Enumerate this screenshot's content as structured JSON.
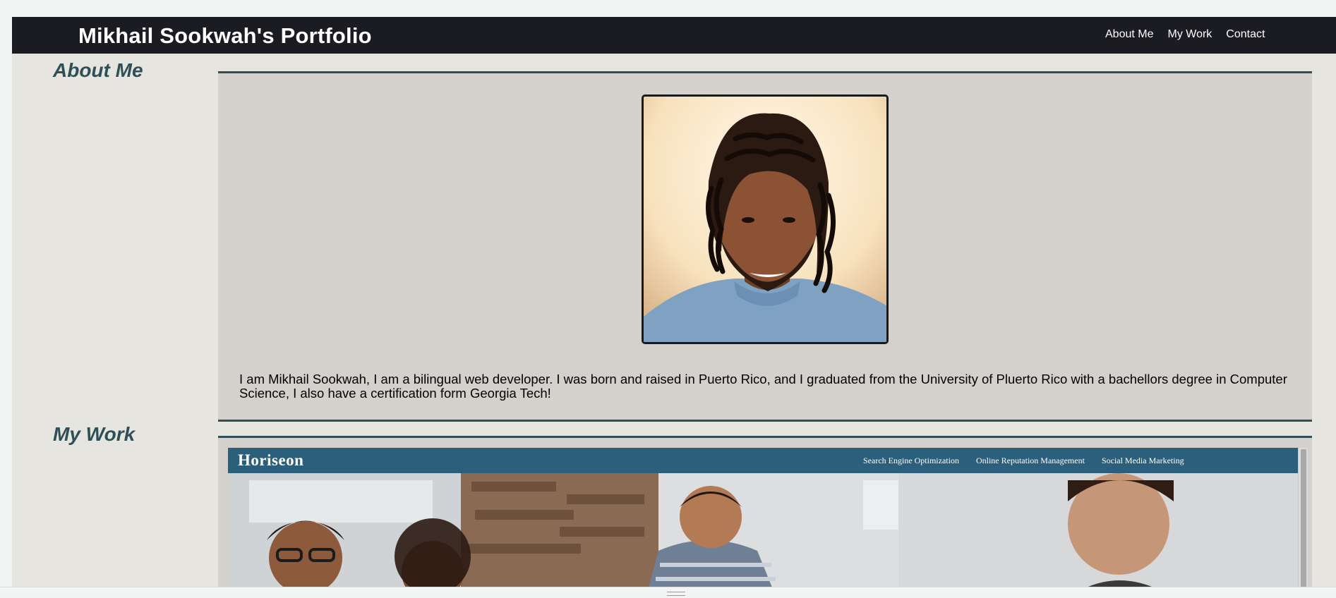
{
  "header": {
    "title": "Mikhail Sookwah's Portfolio",
    "nav": [
      "About Me",
      "My Work",
      "Contact"
    ]
  },
  "about": {
    "heading": "About Me",
    "bio": "I am Mikhail Sookwah, I am a bilingual web developer. I was born and raised in Puerto Rico, and I graduated from the University of Pluerto Rico with a bachellors degree in Computer Science, I also have a certification form Georgia Tech!"
  },
  "work": {
    "heading": "My Work",
    "project": {
      "brand": "Horiseon",
      "links": [
        "Search Engine Optimization",
        "Online Reputation Management",
        "Social Media Marketing"
      ]
    }
  },
  "colors": {
    "header_bg": "#1b1b22",
    "accent": "#2f4f57",
    "page_bg": "#e6e5e0",
    "panel_bg": "#d4d1cc",
    "project_bar": "#2c5f7c"
  },
  "icons": [
    "profile-photo",
    "project-screenshot",
    "resize-grip-icon"
  ]
}
